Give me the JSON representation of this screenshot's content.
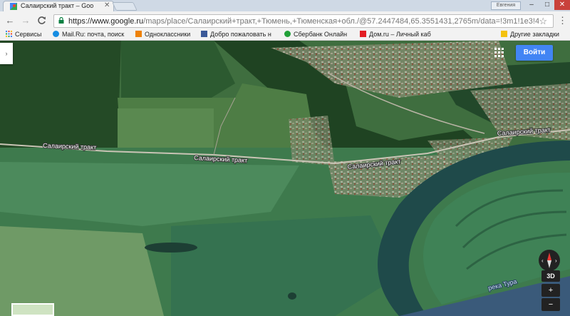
{
  "tab": {
    "title": "Салаирский тракт – Goo",
    "close": "✕"
  },
  "window": {
    "profile": "Евгения",
    "minimize": "–",
    "maximize": "□",
    "close": "✕"
  },
  "nav": {
    "back": "←",
    "forward": "→",
    "reload": "C"
  },
  "omnibox": {
    "url_host": "https://www.google.ru",
    "url_path": "/maps/place/Салаирский+тракт,+Тюмень,+Тюменская+обл./@57.2447484,65.3551431,2765m/data=!3m1!1e3!4",
    "star": "☆"
  },
  "menu": "⋮",
  "bookmarks": [
    {
      "label": "Сервисы",
      "icon": "apps-grid-icon",
      "color": "#4285f4"
    },
    {
      "label": "Mail.Ru: почта, поиск",
      "icon": "mailru-icon",
      "color": "#168de2"
    },
    {
      "label": "Одноклассники",
      "icon": "odnoklassniki-icon",
      "color": "#ee8208"
    },
    {
      "label": "Добро пожаловать н",
      "icon": "facebook-icon",
      "color": "#3b5998"
    },
    {
      "label": "Сбербанк Онлайн",
      "icon": "sberbank-icon",
      "color": "#21a038"
    },
    {
      "label": "Дом.ru – Личный каб",
      "icon": "domru-icon",
      "color": "#e31e24"
    },
    {
      "label": "Другие закладки",
      "icon": "folder-icon",
      "color": "#f4c20d"
    }
  ],
  "map": {
    "road_labels": [
      "Салаирский тракт",
      "Салаирский тракт",
      "Салаирский тракт",
      "Салаирский тракт"
    ],
    "river_label": "река Тура",
    "sign_in": "Войти",
    "btn_3d": "3D",
    "side_toggle": "›",
    "plus": "+",
    "minus": "−",
    "compass_icon": "compass-icon"
  }
}
